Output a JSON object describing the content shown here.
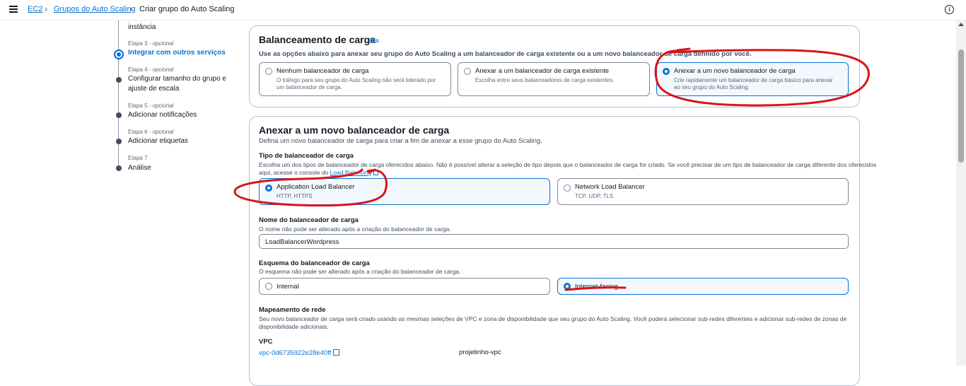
{
  "header": {
    "breadcrumbs": [
      "EC2",
      "Grupos do Auto Scaling",
      "Criar grupo do Auto Scaling"
    ]
  },
  "stepper": {
    "partial_title": "instância",
    "steps": [
      {
        "label": "Etapa 3",
        "optional": "- opcional",
        "title": "Integrar com outros serviços"
      },
      {
        "label": "Etapa 4",
        "optional": "- opcional",
        "title": "Configurar tamanho do grupo e ajuste de escala"
      },
      {
        "label": "Etapa 5",
        "optional": "- opcional",
        "title": "Adicionar notificações"
      },
      {
        "label": "Etapa 6",
        "optional": "- opcional",
        "title": "Adicionar etiquetas"
      },
      {
        "label": "Etapa 7",
        "optional": "",
        "title": "Análise"
      }
    ]
  },
  "load_balancing": {
    "title": "Balanceamento de carga",
    "info": "Info",
    "description": "Use as opções abaixo para anexar seu grupo do Auto Scaling a um balanceador de carga existente ou a um novo balanceador de carga definido por você.",
    "options": [
      {
        "title": "Nenhum balanceador de carga",
        "desc": "O tráfego para seu grupo do Auto Scaling não será liderado por um balanceador de carga."
      },
      {
        "title": "Anexar a um balanceador de carga existente",
        "desc": "Escolha entre seus balanceadores de carga existentes."
      },
      {
        "title": "Anexar a um novo balanceador de carga",
        "desc": "Crie rapidamente um balanceador de carga básico para anexar ao seu grupo do Auto Scaling."
      }
    ]
  },
  "new_lb": {
    "title": "Anexar a um novo balanceador de carga",
    "description": "Defina um novo balanceador de carga para criar a fim de anexar a esse grupo do Auto Scaling.",
    "type_label": "Tipo de balanceador de carga",
    "type_desc_1": "Escolha um dos tipos de balanceador de carga oferecidos abaixo. Não é possível alterar a seleção de tipo depois que o balanceador de carga for criado. Se você precisar de um tipo de balanceador de carga diferente dos oferecidos",
    "type_desc_2": "aqui, acesse o console do ",
    "type_link": "Load Balancing",
    "types": [
      {
        "title": "Application Load Balancer",
        "desc": "HTTP, HTTPS"
      },
      {
        "title": "Network Load Balancer",
        "desc": "TCP, UDP, TLS"
      }
    ],
    "name_label": "Nome do balanceador de carga",
    "name_desc": "O nome não pode ser alterado após a criação do balanceador de carga.",
    "name_value": "LoadBalancerWordpress",
    "scheme_label": "Esquema do balanceador de carga",
    "scheme_desc": "O esquema não pode ser alterado após a criação do balanceador de carga.",
    "schemes": [
      "Internal",
      "Internet-facing"
    ],
    "mapping_label": "Mapeamento de rede",
    "mapping_desc_1": "Seu novo balanceador de carga será criado usando as mesmas seleções de VPC e zona de disponibilidade que seu grupo do Auto Scaling. Você poderá selecionar sub-redes diferentes e adicionar sub-redes de zonas de",
    "mapping_desc_2": "disponibilidade adicionais.",
    "vpc_label": "VPC",
    "vpc_id": "vpc-0d6735922e28e40ff",
    "vpc_name": "projetinho-vpc"
  }
}
